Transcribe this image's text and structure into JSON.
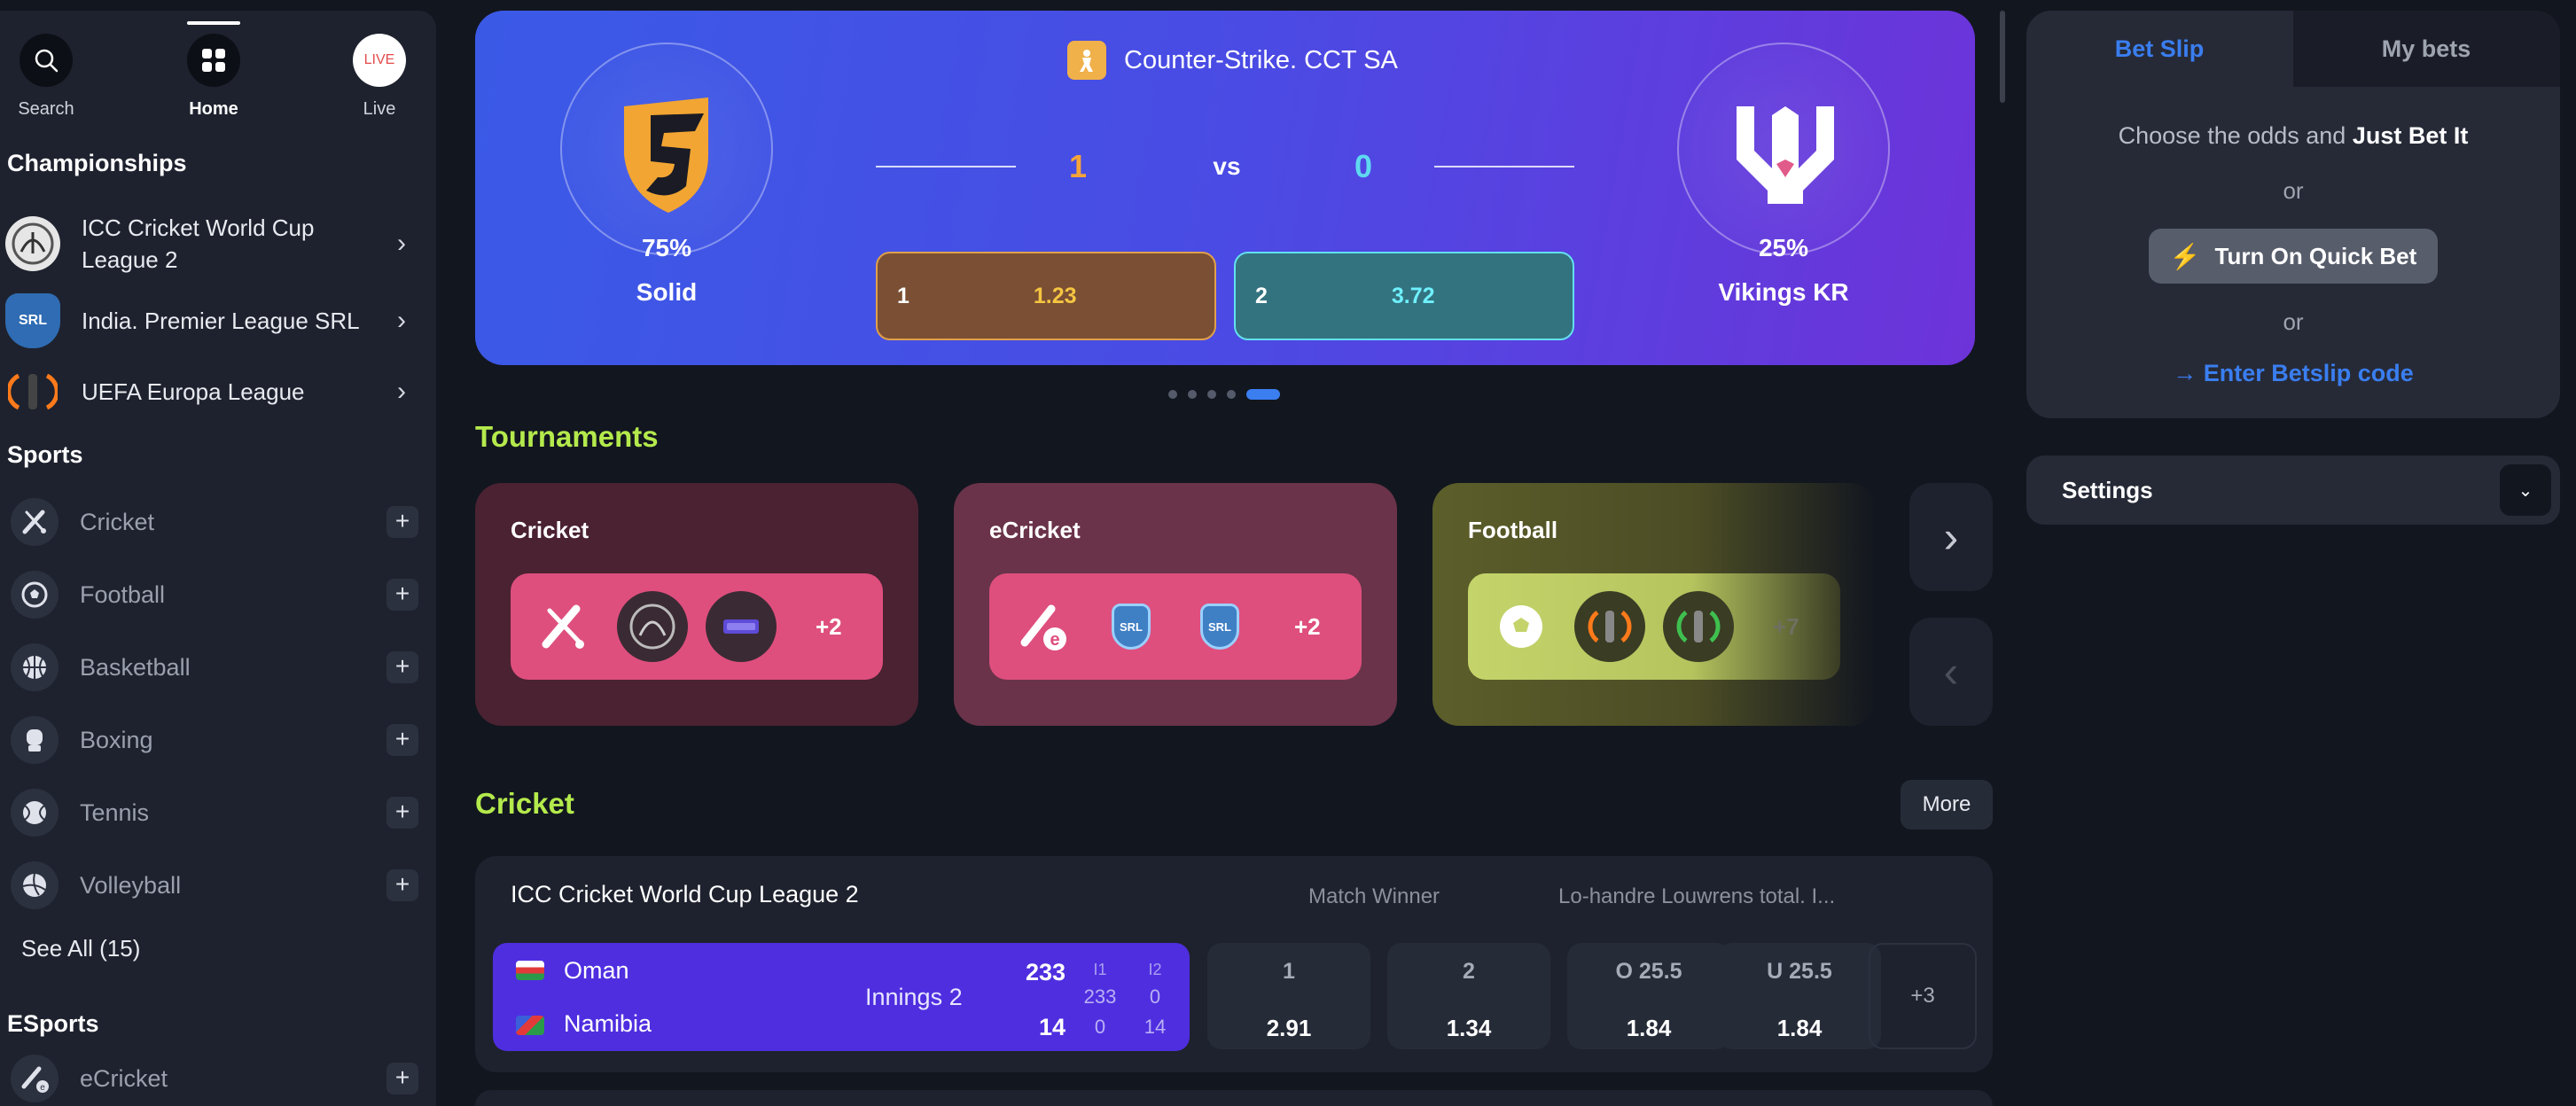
{
  "nav": {
    "search_label": "Search",
    "home_label": "Home",
    "live_label": "Live",
    "live_badge": "LIVE"
  },
  "sidebar": {
    "championships_title": "Championships",
    "championships": [
      {
        "label": "ICC Cricket World Cup League 2"
      },
      {
        "label": "India. Premier League SRL",
        "badge": "SRL"
      },
      {
        "label": "UEFA Europa League"
      }
    ],
    "sports_title": "Sports",
    "sports": [
      {
        "label": "Cricket",
        "icon": "cricket-icon"
      },
      {
        "label": "Football",
        "icon": "football-icon"
      },
      {
        "label": "Basketball",
        "icon": "basketball-icon"
      },
      {
        "label": "Boxing",
        "icon": "boxing-icon"
      },
      {
        "label": "Tennis",
        "icon": "tennis-icon"
      },
      {
        "label": "Volleyball",
        "icon": "volleyball-icon"
      }
    ],
    "see_all": "See All (15)",
    "esports_title": "ESports",
    "esports": [
      {
        "label": "eCricket",
        "icon": "ecricket-icon"
      }
    ]
  },
  "hero": {
    "event": "Counter-Strike. CCT SA",
    "home": {
      "name": "Solid",
      "percent": "75%",
      "score": "1",
      "odd_label": "1",
      "odd_value": "1.23"
    },
    "away": {
      "name": "Vikings KR",
      "percent": "25%",
      "score": "0",
      "odd_label": "2",
      "odd_value": "3.72"
    },
    "vs": "vs",
    "slides_total": 5,
    "slide_active": 5
  },
  "tournaments": {
    "title": "Tournaments",
    "cards": [
      {
        "title": "Cricket",
        "more": "+2"
      },
      {
        "title": "eCricket",
        "more": "+2",
        "badge": "SRL"
      },
      {
        "title": "Football",
        "more": "+7"
      }
    ]
  },
  "cricket": {
    "title": "Cricket",
    "more_button": "More",
    "league": "ICC Cricket World Cup League 2",
    "col_match_winner": "Match Winner",
    "col_total": "Lo-handre Louwrens total. I...",
    "match": {
      "team1": "Oman",
      "team2": "Namibia",
      "status": "Innings 2",
      "score1": "233",
      "score2": "14",
      "i1_label": "I1",
      "i2_label": "I2",
      "i1_team1": "233",
      "i2_team1": "0",
      "i1_team2": "0",
      "i2_team2": "14"
    },
    "odds": [
      {
        "label": "1",
        "value": "2.91"
      },
      {
        "label": "2",
        "value": "1.34"
      },
      {
        "label": "O 25.5",
        "value": "1.84"
      },
      {
        "label": "U 25.5",
        "value": "1.84"
      }
    ],
    "more_markets": "+3"
  },
  "betslip": {
    "tab_active": "Bet Slip",
    "tab_other": "My bets",
    "prompt": "Choose the odds and ",
    "prompt_bold": "Just Bet It",
    "or1": "or",
    "quick_bet": "Turn On Quick Bet",
    "or2": "or",
    "betslip_code": "→ Enter Betslip code"
  },
  "settings": {
    "label": "Settings"
  },
  "colors": {
    "accent_green": "#b4ea4c",
    "accent_blue": "#3a7ef0",
    "live_red": "#e34b4b",
    "match_purple": "#4f2ee0"
  }
}
